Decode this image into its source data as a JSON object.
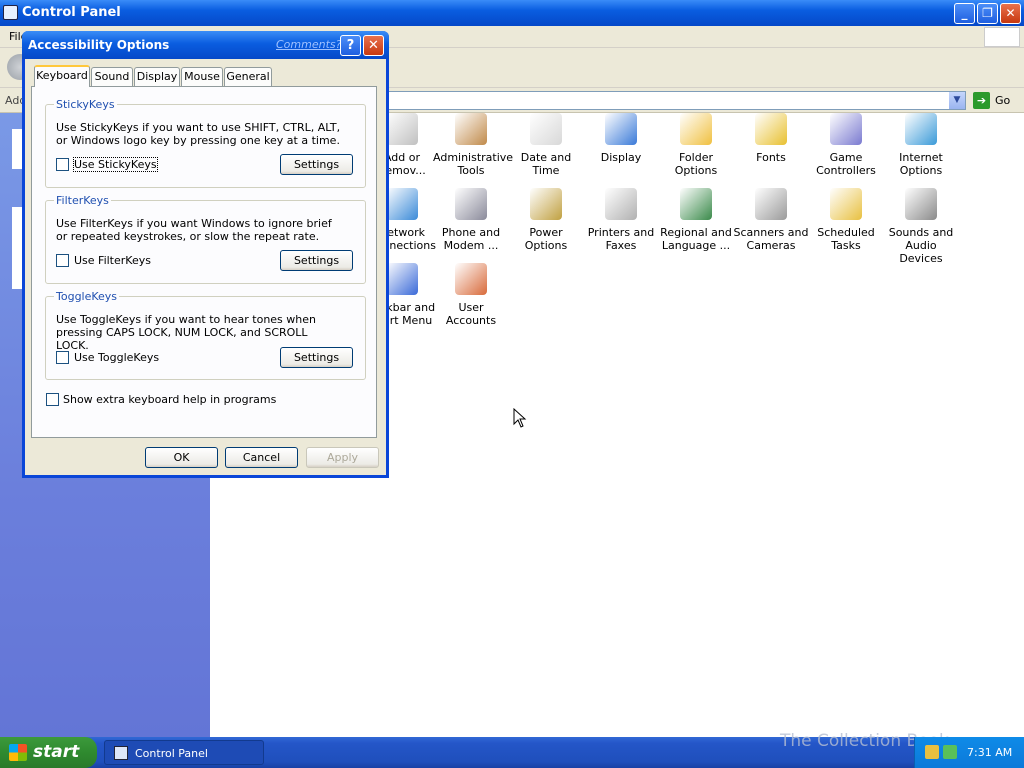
{
  "window": {
    "title": "Control Panel",
    "menu_partial": "File",
    "address_label": "Address",
    "go_label": "Go"
  },
  "items": [
    {
      "label": "Add or\nRemov...",
      "icon": "add-remove-icon",
      "color": "#c0c0c0"
    },
    {
      "label": "Administrative\nTools",
      "icon": "admin-tools-icon",
      "color": "#c08a4a"
    },
    {
      "label": "Date and Time",
      "icon": "date-time-icon",
      "color": "#d8d8d8"
    },
    {
      "label": "Display",
      "icon": "display-icon",
      "color": "#3a7ad8"
    },
    {
      "label": "Folder Options",
      "icon": "folder-options-icon",
      "color": "#f0c040"
    },
    {
      "label": "Fonts",
      "icon": "fonts-icon",
      "color": "#e8c030"
    },
    {
      "label": "Game\nControllers",
      "icon": "game-controllers-icon",
      "color": "#7a7ad0"
    },
    {
      "label": "Internet\nOptions",
      "icon": "internet-options-icon",
      "color": "#3a9ad8"
    },
    {
      "label": "Network\nConnections",
      "icon": "network-connections-icon",
      "color": "#3a8ad8"
    },
    {
      "label": "Phone and\nModem ...",
      "icon": "phone-modem-icon",
      "color": "#8a8a9a"
    },
    {
      "label": "Power Options",
      "icon": "power-options-icon",
      "color": "#c0a040"
    },
    {
      "label": "Printers and\nFaxes",
      "icon": "printers-faxes-icon",
      "color": "#b0b0b0"
    },
    {
      "label": "Regional and\nLanguage ...",
      "icon": "regional-language-icon",
      "color": "#3a8a4a"
    },
    {
      "label": "Scanners and\nCameras",
      "icon": "scanners-cameras-icon",
      "color": "#9a9a9a"
    },
    {
      "label": "Scheduled\nTasks",
      "icon": "scheduled-tasks-icon",
      "color": "#e8c040"
    },
    {
      "label": "Sounds and\nAudio Devices",
      "icon": "sounds-audio-icon",
      "color": "#8a8a8a"
    },
    {
      "label": "Taskbar and\nStart Menu",
      "icon": "taskbar-start-icon",
      "color": "#3a6ad8"
    },
    {
      "label": "User Accounts",
      "icon": "user-accounts-icon",
      "color": "#d86a3a"
    }
  ],
  "dialog": {
    "title": "Accessibility Options",
    "comments": "Comments?",
    "help": "?",
    "close": "✕",
    "tabs": [
      "Keyboard",
      "Sound",
      "Display",
      "Mouse",
      "General"
    ],
    "stickykeys": {
      "title": "StickyKeys",
      "desc": "Use StickyKeys if you want to use SHIFT, CTRL, ALT, or Windows logo key by pressing one key at a time.",
      "check": "Use StickyKeys",
      "settings": "Settings"
    },
    "filterkeys": {
      "title": "FilterKeys",
      "desc": "Use FilterKeys if you want Windows to ignore brief or repeated keystrokes, or slow the repeat rate.",
      "check": "Use FilterKeys",
      "settings": "Settings"
    },
    "togglekeys": {
      "title": "ToggleKeys",
      "desc": "Use ToggleKeys if you want to hear tones when pressing CAPS LOCK, NUM LOCK, and SCROLL LOCK.",
      "check": "Use ToggleKeys",
      "settings": "Settings"
    },
    "extra_help": "Show extra keyboard help in programs",
    "ok": "OK",
    "cancel": "Cancel",
    "apply": "Apply"
  },
  "taskbar": {
    "start": "start",
    "task": "Control Panel",
    "clock": "7:31 AM",
    "watermark": "The Collection Book"
  }
}
